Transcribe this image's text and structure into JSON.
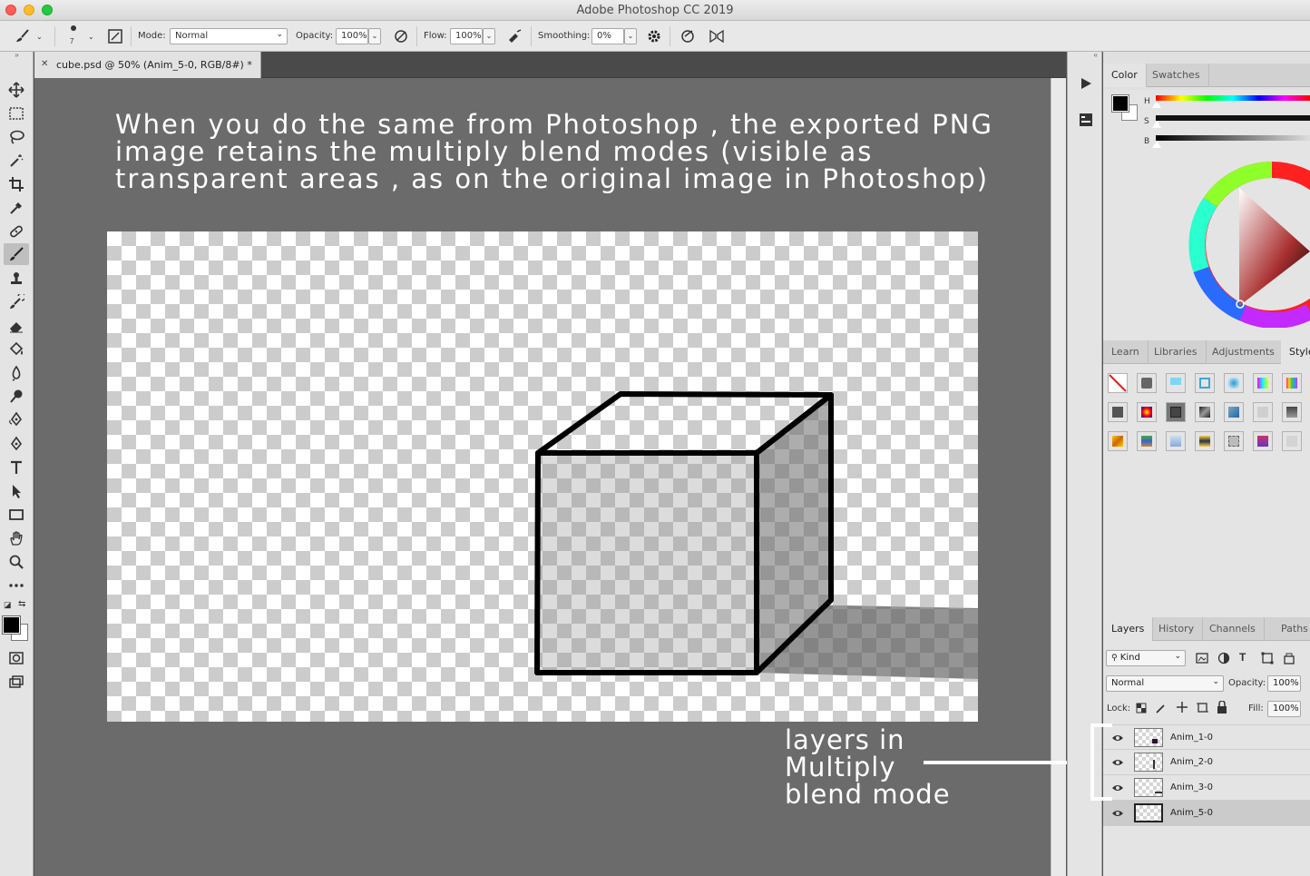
{
  "window": {
    "title": "Adobe Photoshop CC 2019"
  },
  "options_bar": {
    "brush_size": "7",
    "mode_label": "Mode:",
    "mode_value": "Normal",
    "opacity_label": "Opacity:",
    "opacity_value": "100%",
    "flow_label": "Flow:",
    "flow_value": "100%",
    "smoothing_label": "Smoothing:",
    "smoothing_value": "0%"
  },
  "document": {
    "tab_title": "cube.psd @ 50% (Anim_5-0, RGB/8#) *"
  },
  "annotations": {
    "top_text": "When you do the same from Photoshop , the exported PNG image retains the multiply blend modes (visible as transparent areas , as on the original image in Photoshop)",
    "right_line1": "layers in",
    "right_line2": "Multiply",
    "right_line3": "blend mode"
  },
  "color_panel": {
    "tabs": [
      "Color",
      "Swatches"
    ],
    "active_tab": "Color",
    "slider_labels": [
      "H",
      "S",
      "B"
    ],
    "foreground": "#000000",
    "background": "#ffffff"
  },
  "styles_panel": {
    "tabs": [
      "Learn",
      "Libraries",
      "Adjustments",
      "Style"
    ]
  },
  "layers_panel": {
    "tabs": [
      "Layers",
      "History",
      "Channels",
      "Paths"
    ],
    "filter_value": "Kind",
    "blend_value": "Normal",
    "opacity_label": "Opacity:",
    "opacity_value": "100%",
    "lock_label": "Lock:",
    "fill_label": "Fill:",
    "fill_value": "100%",
    "layers": [
      {
        "name": "Anim_1-0",
        "selected": false
      },
      {
        "name": "Anim_2-0",
        "selected": false
      },
      {
        "name": "Anim_3-0",
        "selected": false
      },
      {
        "name": "Anim_5-0",
        "selected": true
      }
    ]
  },
  "icons": {
    "tools": [
      "move-icon",
      "marquee-icon",
      "lasso-icon",
      "magic-wand-icon",
      "crop-icon",
      "eyedropper-icon",
      "healing-icon",
      "brush-icon",
      "stamp-icon",
      "history-brush-icon",
      "eraser-icon",
      "paint-bucket-icon",
      "blur-icon",
      "dodge-icon",
      "pen-icon",
      "pen-icon",
      "type-icon",
      "path-select-icon",
      "rectangle-icon",
      "hand-icon",
      "zoom-icon",
      "more-icon"
    ]
  }
}
